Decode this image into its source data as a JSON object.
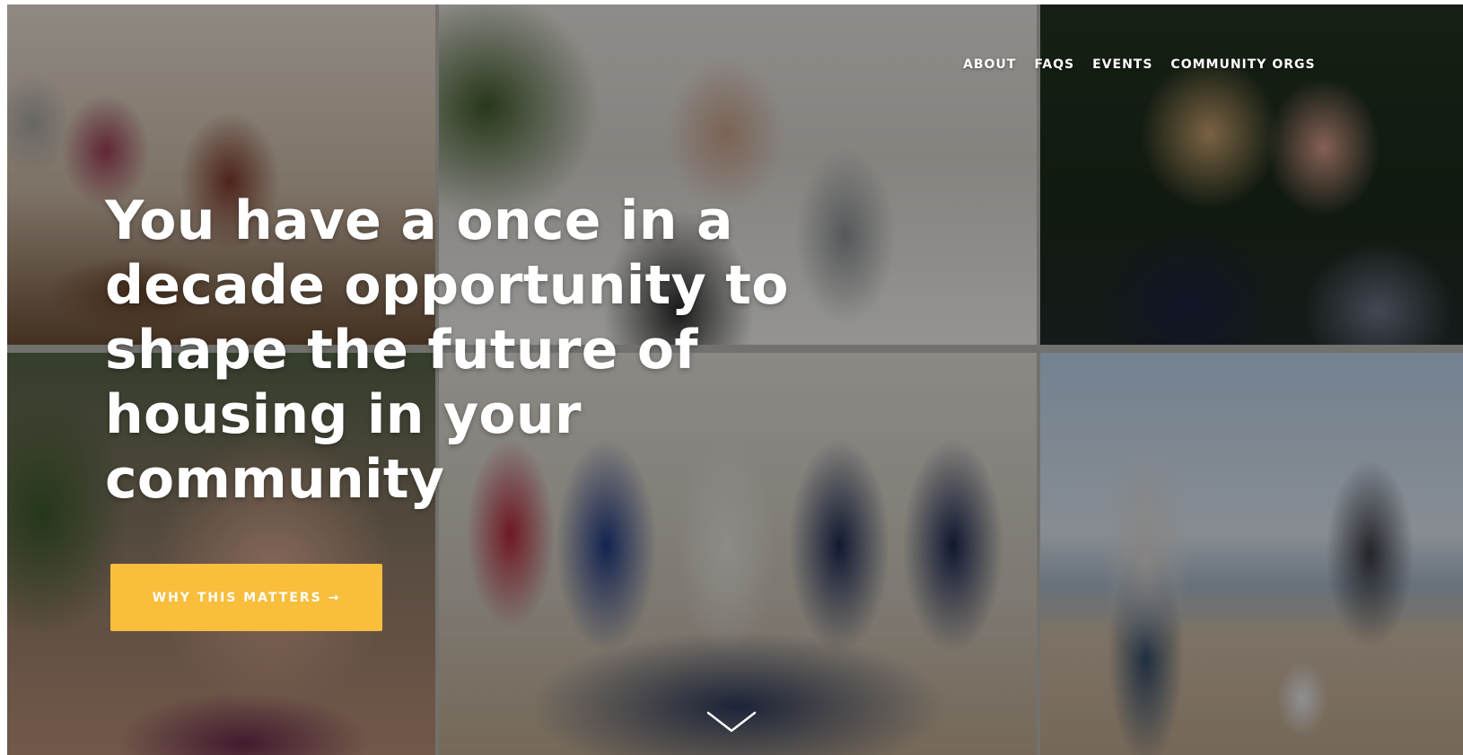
{
  "nav": {
    "items": [
      {
        "label": "ABOUT"
      },
      {
        "label": "FAQS"
      },
      {
        "label": "EVENTS"
      },
      {
        "label": "COMMUNITY ORGS"
      }
    ]
  },
  "hero": {
    "headline_lines": [
      "You have a once in a",
      "decade opportunity to",
      "shape the future of",
      "housing in your",
      "community"
    ],
    "cta_label": "WHY THIS MATTERS →"
  },
  "colors": {
    "cta_background": "#f8be3c",
    "text": "#ffffff",
    "overlay": "rgba(0,0,0,0.38)"
  },
  "icons": {
    "scroll": "chevron-down-icon"
  }
}
